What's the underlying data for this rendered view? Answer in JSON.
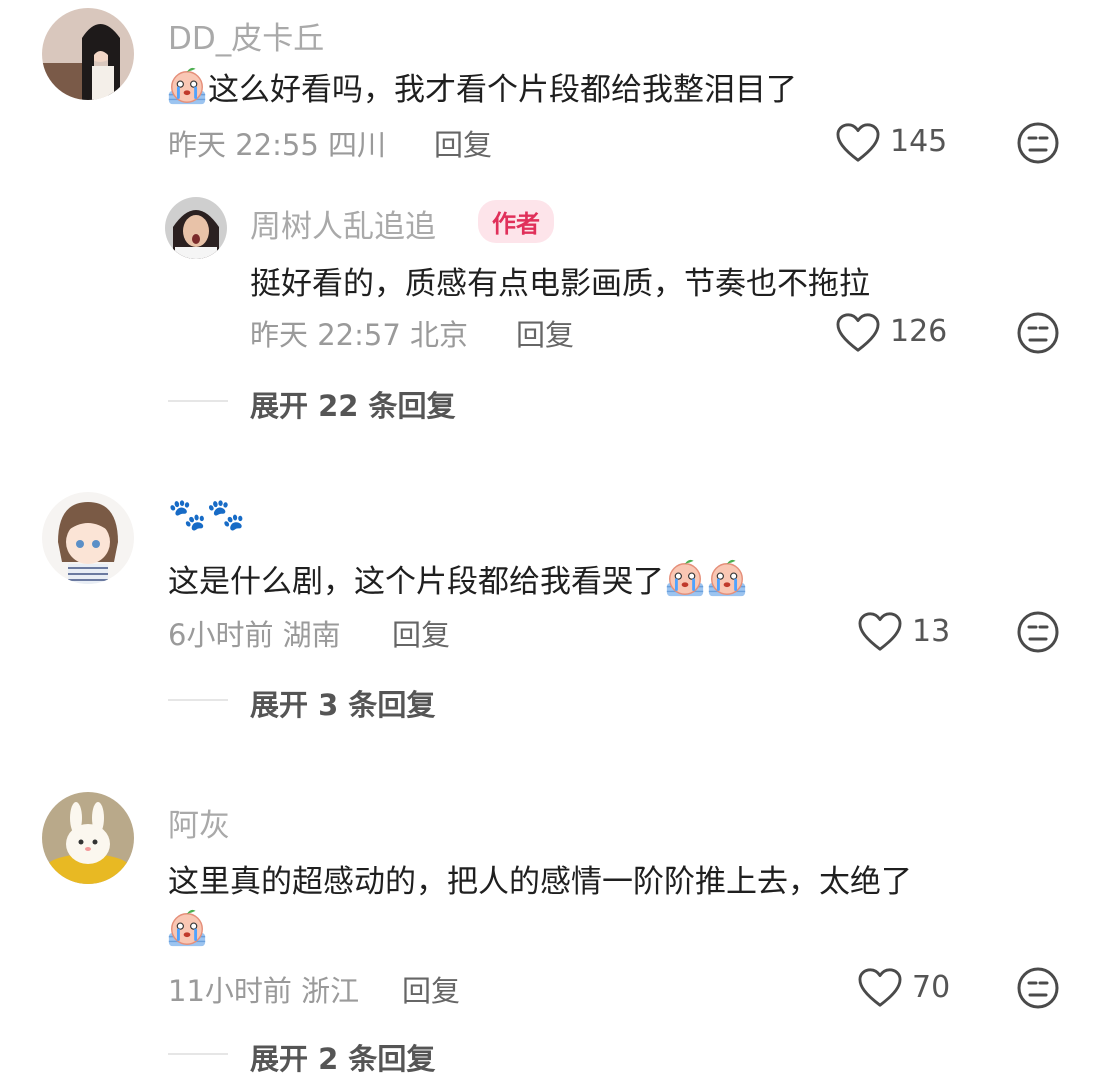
{
  "colors": {
    "author_badge_bg": "#fde4ea",
    "author_badge_text": "#e0305a",
    "meta_gray": "#9a9a9a"
  },
  "comments": [
    {
      "username": "DD_皮卡丘",
      "text": "这么好看吗，我才看个片段都给我整泪目了",
      "emoji": "crying-face-icon",
      "time": "昨天 22:55",
      "location": "四川",
      "reply_label": "回复",
      "likes": "145",
      "sub_reply": {
        "username": "周树人乱追追",
        "badge": "作者",
        "text": "挺好看的，质感有点电影画质，节奏也不拖拉",
        "time": "昨天 22:57",
        "location": "北京",
        "reply_label": "回复",
        "likes": "126"
      },
      "expand": "展开 22 条回复"
    },
    {
      "username": "🐾🐾",
      "text": "这是什么剧，这个片段都给我看哭了",
      "emoji": "crying-face-icon",
      "time": "6小时前",
      "location": "湖南",
      "reply_label": "回复",
      "likes": "13",
      "expand": "展开 3 条回复"
    },
    {
      "username": "阿灰",
      "text": "这里真的超感动的，把人的感情一阶阶推上去，太绝了",
      "emoji": "crying-face-icon",
      "time": "11小时前",
      "location": "浙江",
      "reply_label": "回复",
      "likes": "70",
      "expand": "展开 2 条回复"
    }
  ]
}
